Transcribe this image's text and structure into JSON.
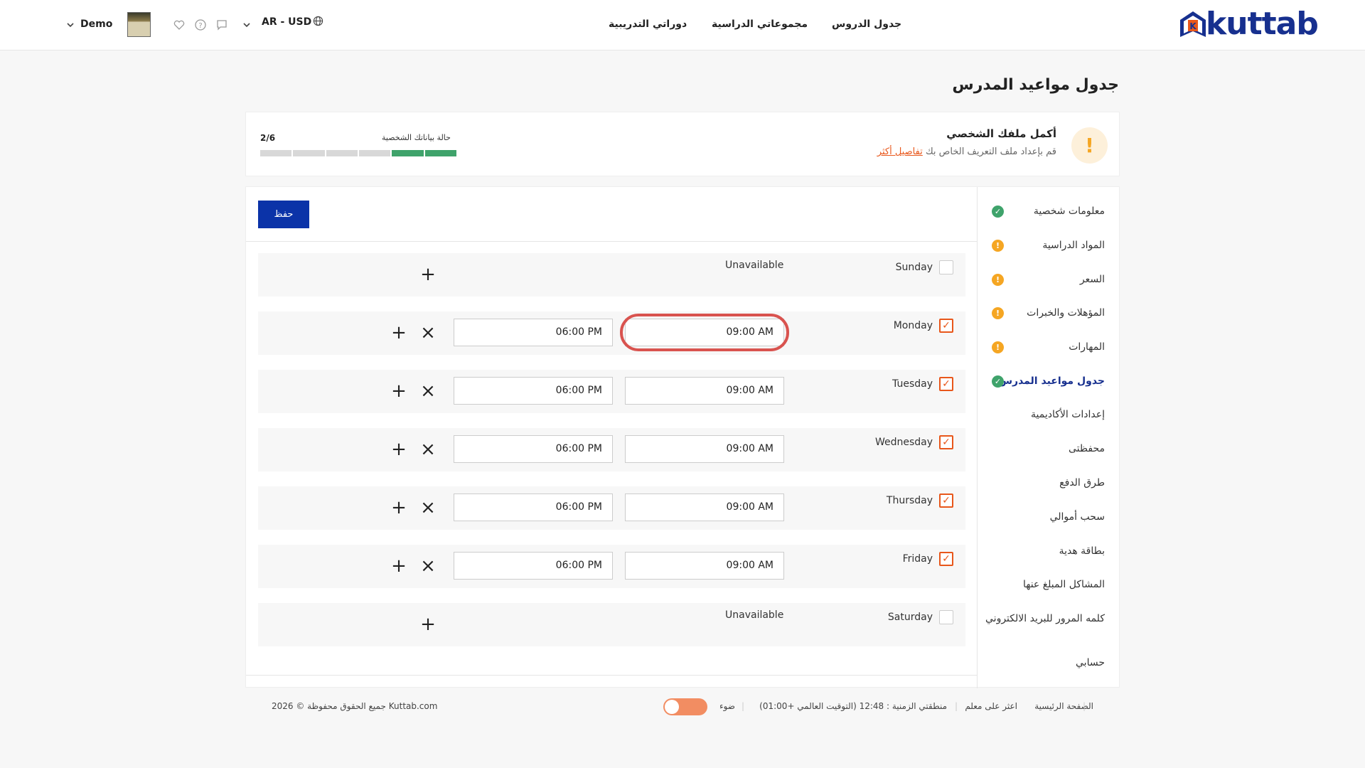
{
  "header": {
    "logo_text": "kuttab",
    "nav": [
      "جدول الدروس",
      "مجموعاتي الدراسية",
      "دوراتي التدريبية"
    ],
    "lang": "AR - USD",
    "user": "Demo"
  },
  "page": {
    "title": "جدول مواعيد المدرس"
  },
  "profile": {
    "title": "أكمل ملفك الشخصي",
    "subtitle": "قم بإعداد ملف التعريف الخاص بك",
    "link": "تفاصيل أكثر",
    "status_label": "حالة بياناتك الشخصية",
    "count": "2/6",
    "completed": 2,
    "total": 6
  },
  "sidebar": {
    "items": [
      {
        "label": "معلومات شخصية",
        "status": "ok"
      },
      {
        "label": "المواد الدراسية",
        "status": "warn"
      },
      {
        "label": "السعر",
        "status": "warn"
      },
      {
        "label": "المؤهلات والخبرات",
        "status": "warn"
      },
      {
        "label": "المهارات",
        "status": "warn"
      },
      {
        "label": "جدول مواعيد المدرس",
        "status": "ok",
        "active": true
      },
      {
        "label": "إعدادات الأكاديمية"
      },
      {
        "label": "محفظتى"
      },
      {
        "label": "طرق الدفع"
      },
      {
        "label": "سحب أموالي"
      },
      {
        "label": "بطاقة هدية"
      },
      {
        "label": "المشاكل المبلغ عنها"
      },
      {
        "label": "كلمه المرور للبريد الالكتروني"
      },
      {
        "label": "حسابي"
      }
    ]
  },
  "schedule": {
    "save_label": "حفظ",
    "unavailable_label": "Unavailable",
    "days": [
      {
        "name": "Sunday",
        "checked": false
      },
      {
        "name": "Monday",
        "checked": true,
        "start": "09:00 AM",
        "end": "06:00 PM",
        "highlighted": true
      },
      {
        "name": "Tuesday",
        "checked": true,
        "start": "09:00 AM",
        "end": "06:00 PM"
      },
      {
        "name": "Wednesday",
        "checked": true,
        "start": "09:00 AM",
        "end": "06:00 PM"
      },
      {
        "name": "Thursday",
        "checked": true,
        "start": "09:00 AM",
        "end": "06:00 PM"
      },
      {
        "name": "Friday",
        "checked": true,
        "start": "09:00 AM",
        "end": "06:00 PM"
      },
      {
        "name": "Saturday",
        "checked": false
      }
    ]
  },
  "footer": {
    "home": "الصفحة الرئيسية",
    "find_teacher": "اعثر على معلم",
    "timezone": "منطقتي الزمنية : 12:48 (التوقيت العالمي +01:00)",
    "light": "ضوء",
    "copyright": "جميع الحقوق محفوظة © 2026 Kuttab.com"
  },
  "colors": {
    "brand": "#17308f",
    "accent": "#e8571b",
    "ok": "#3fa36b",
    "warn": "#f5a623",
    "highlight_ring": "#d9534f"
  }
}
